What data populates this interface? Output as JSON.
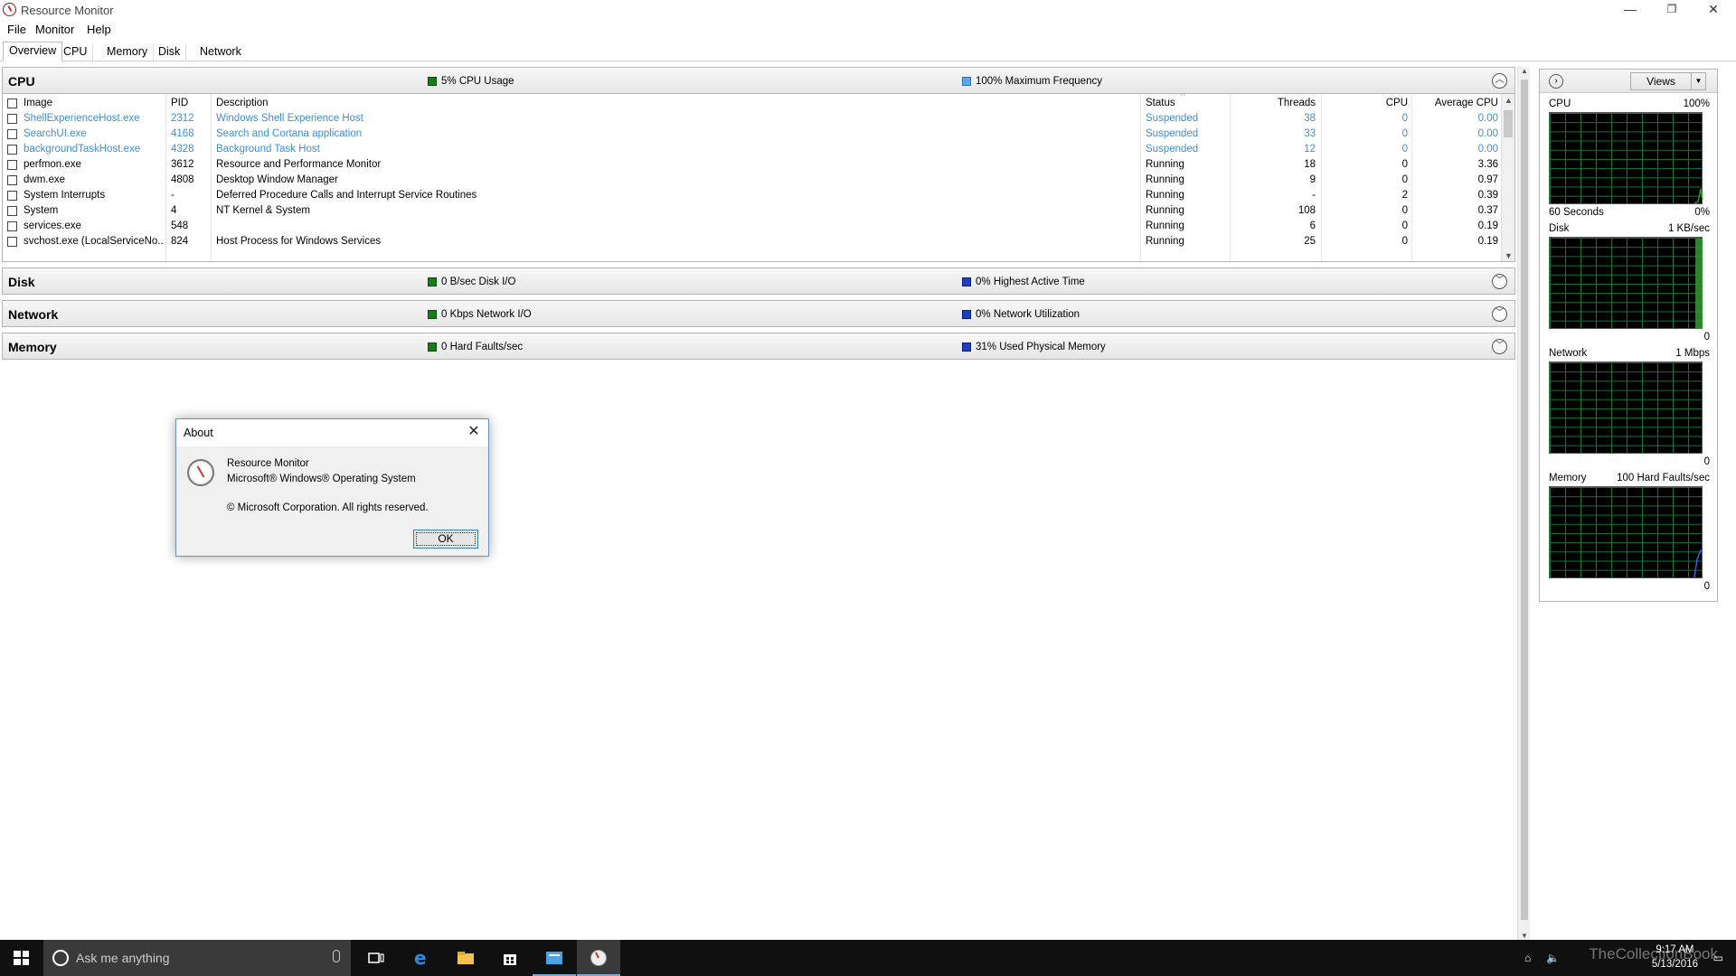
{
  "window": {
    "title": "Resource Monitor",
    "controls": {
      "minimize": "—",
      "restore": "❐",
      "close": "✕"
    }
  },
  "menu": [
    "File",
    "Monitor",
    "Help"
  ],
  "tabs": [
    "Overview",
    "CPU",
    "Memory",
    "Disk",
    "Network"
  ],
  "active_tab": "Overview",
  "sections": {
    "cpu": {
      "title": "CPU",
      "metric1": "5% CPU Usage",
      "metric2": "100% Maximum Frequency",
      "state": "expanded"
    },
    "disk": {
      "title": "Disk",
      "metric1": "0 B/sec Disk I/O",
      "metric2": "0% Highest Active Time",
      "state": "collapsed"
    },
    "network": {
      "title": "Network",
      "metric1": "0 Kbps Network I/O",
      "metric2": "0% Network Utilization",
      "state": "collapsed"
    },
    "memory": {
      "title": "Memory",
      "metric1": "0 Hard Faults/sec",
      "metric2": "31% Used Physical Memory",
      "state": "collapsed"
    }
  },
  "cpu_table": {
    "headers": {
      "image": "Image",
      "pid": "PID",
      "description": "Description",
      "status": "Status",
      "threads": "Threads",
      "cpu": "CPU",
      "avg_cpu": "Average CPU"
    },
    "rows": [
      {
        "image": "ShellExperienceHost.exe",
        "pid": "2312",
        "description": "Windows Shell Experience Host",
        "status": "Suspended",
        "threads": "38",
        "cpu": "0",
        "avg_cpu": "0.00"
      },
      {
        "image": "SearchUI.exe",
        "pid": "4168",
        "description": "Search and Cortana application",
        "status": "Suspended",
        "threads": "33",
        "cpu": "0",
        "avg_cpu": "0.00"
      },
      {
        "image": "backgroundTaskHost.exe",
        "pid": "4328",
        "description": "Background Task Host",
        "status": "Suspended",
        "threads": "12",
        "cpu": "0",
        "avg_cpu": "0.00"
      },
      {
        "image": "perfmon.exe",
        "pid": "3612",
        "description": "Resource and Performance Monitor",
        "status": "Running",
        "threads": "18",
        "cpu": "0",
        "avg_cpu": "3.36"
      },
      {
        "image": "dwm.exe",
        "pid": "4808",
        "description": "Desktop Window Manager",
        "status": "Running",
        "threads": "9",
        "cpu": "0",
        "avg_cpu": "0.97"
      },
      {
        "image": "System Interrupts",
        "pid": "-",
        "description": "Deferred Procedure Calls and Interrupt Service Routines",
        "status": "Running",
        "threads": "-",
        "cpu": "2",
        "avg_cpu": "0.39"
      },
      {
        "image": "System",
        "pid": "4",
        "description": "NT Kernel & System",
        "status": "Running",
        "threads": "108",
        "cpu": "0",
        "avg_cpu": "0.37"
      },
      {
        "image": "services.exe",
        "pid": "548",
        "description": "",
        "status": "Running",
        "threads": "6",
        "cpu": "0",
        "avg_cpu": "0.19"
      },
      {
        "image": "svchost.exe (LocalServiceNo...",
        "pid": "824",
        "description": "Host Process for Windows Services",
        "status": "Running",
        "threads": "25",
        "cpu": "0",
        "avg_cpu": "0.19"
      }
    ]
  },
  "side_panel": {
    "views_label": "Views",
    "graphs": [
      {
        "name": "CPU",
        "top_right": "100%",
        "bottom_left": "60 Seconds",
        "bottom_right": "0%",
        "color": "#2e9e2e"
      },
      {
        "name": "Disk",
        "top_right": "1 KB/sec",
        "bottom_left": "",
        "bottom_right": "0",
        "color": "#2e9e2e"
      },
      {
        "name": "Network",
        "top_right": "1 Mbps",
        "bottom_left": "",
        "bottom_right": "0",
        "color": "#2e9e2e"
      },
      {
        "name": "Memory",
        "top_right": "100 Hard Faults/sec",
        "bottom_left": "",
        "bottom_right": "0",
        "color": "#3a5fd6"
      }
    ]
  },
  "dialog": {
    "title": "About",
    "line1": "Resource Monitor",
    "line2": "Microsoft® Windows® Operating System",
    "line3": "© Microsoft Corporation. All rights reserved.",
    "ok_label": "OK"
  },
  "taskbar": {
    "search_placeholder": "Ask me anything",
    "time": "9:17 AM",
    "date": "5/13/2016",
    "watermark": "TheCollectionBook"
  },
  "colors": {
    "suspended_text": "#3d8fd6",
    "graph_grid": "#0c7a3a",
    "metric_green": "#1b7a1b",
    "metric_blue": "#1f3fbf"
  }
}
